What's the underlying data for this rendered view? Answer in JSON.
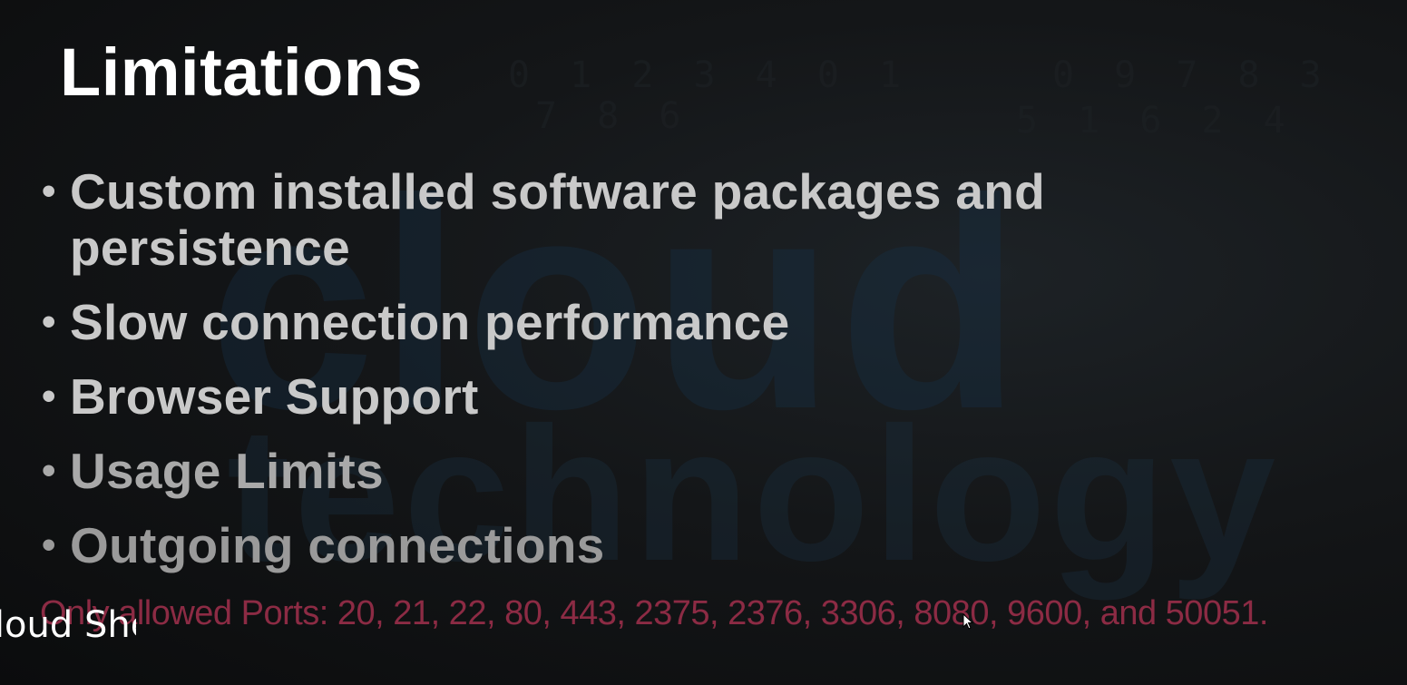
{
  "slide": {
    "title": "Limitations",
    "background_words": [
      "cloud",
      "technology"
    ],
    "background_digits": [
      "0 1 2 3 4 0 1",
      "7 8 6",
      "0 9 7 8 3",
      "5 1 6 2 4"
    ],
    "bullets": [
      {
        "text": "Custom installed software packages and persistence"
      },
      {
        "text": "Slow connection performance"
      },
      {
        "text": "Browser Support"
      },
      {
        "text": "Usage Limits"
      },
      {
        "text": "Outgoing connections"
      }
    ],
    "bullet_glyph": "•",
    "footnote": "Only allowed Ports: 20, 21, 22, 80, 443, 2375, 2376, 3306, 8080, 9600, and 50051.",
    "colors": {
      "title": "#ffffff",
      "bullet_text": "#c9c9c9",
      "footnote": "#8c2b44",
      "background": "#0e0f10"
    }
  },
  "overlay": {
    "caption": "Cloud Shell"
  },
  "cursor": {
    "icon": "mouse-pointer-icon"
  }
}
